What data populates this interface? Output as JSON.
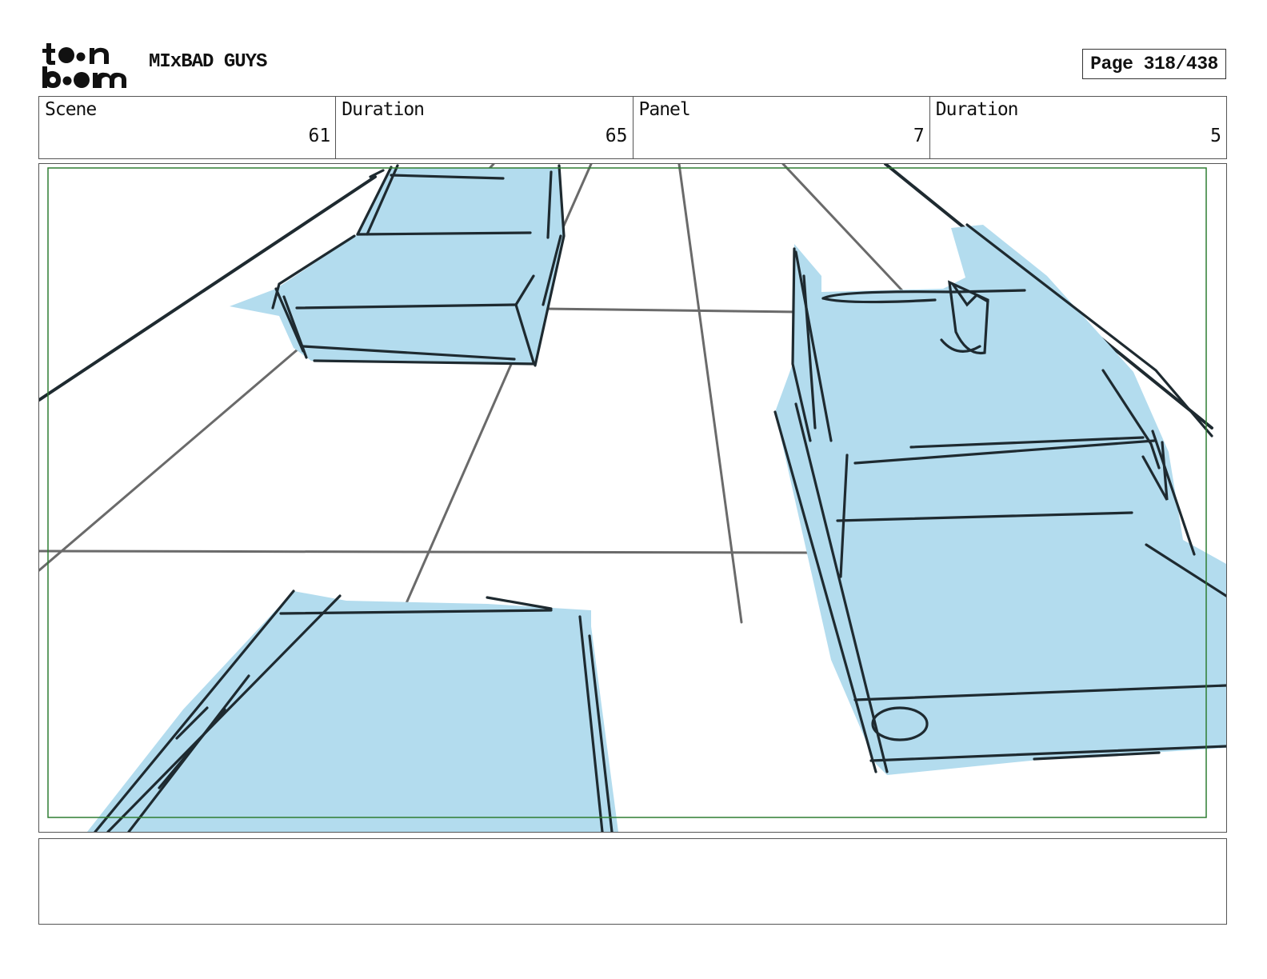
{
  "header": {
    "logo_text": "toon boom",
    "project_title": "MIxBAD GUYS",
    "page_label": "Page 318/438"
  },
  "info": {
    "scene_label": "Scene",
    "scene_value": "61",
    "scene_duration_label": "Duration",
    "scene_duration_value": "65",
    "panel_label": "Panel",
    "panel_value": "7",
    "panel_duration_label": "Duration",
    "panel_duration_value": "5"
  },
  "colors": {
    "fill": "#b3dcee",
    "ink": "#1e2a30",
    "guide": "#6a6a6a",
    "safe_frame": "#2e7d32"
  },
  "notes": {
    "text": ""
  }
}
